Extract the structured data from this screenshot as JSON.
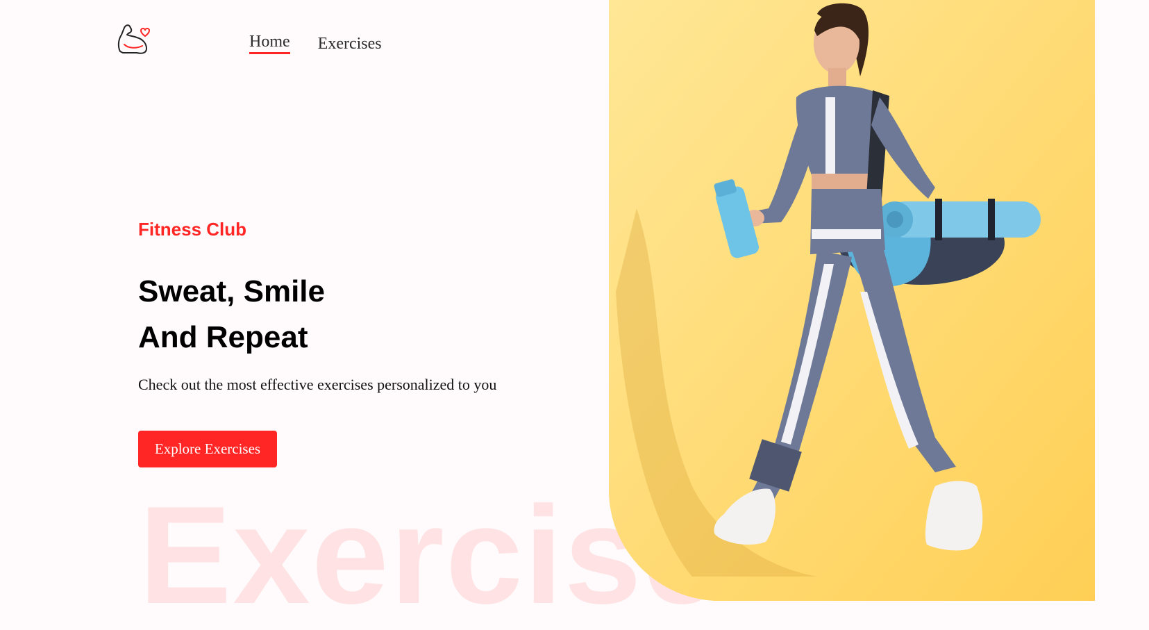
{
  "navbar": {
    "logo_icon": "muscle-heart-icon",
    "links": [
      {
        "label": "Home",
        "active": true
      },
      {
        "label": "Exercises",
        "active": false
      }
    ]
  },
  "hero": {
    "eyebrow": "Fitness Club",
    "headline_line1": "Sweat, Smile",
    "headline_line2": "And Repeat",
    "subtext": "Check out the most effective exercises personalized to you",
    "cta_label": "Explore Exercises",
    "watermark": "Exercise"
  },
  "banner": {
    "alt": "Woman walking with water bottle and yoga mat bag"
  },
  "colors": {
    "accent": "#ff2625",
    "background": "#fffafb",
    "banner_bg": "#ffdb73"
  }
}
